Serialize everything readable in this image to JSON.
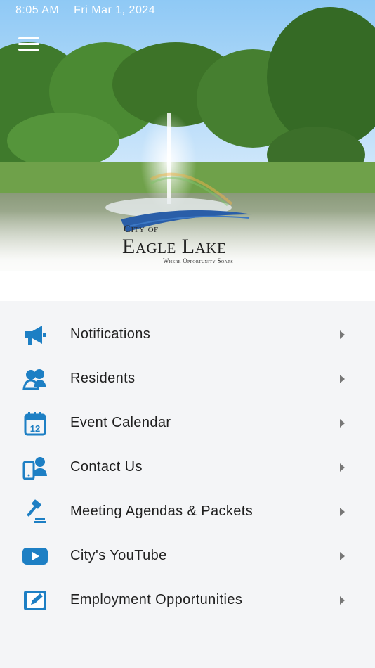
{
  "status_bar": {
    "time": "8:05 AM",
    "date": "Fri Mar 1, 2024"
  },
  "header": {
    "menu_icon": "hamburger-menu-icon",
    "logo": {
      "line1": "City of",
      "line2": "Eagle Lake",
      "tagline": "Where Opportunity Soars"
    }
  },
  "colors": {
    "accent": "#1d7fc4",
    "text": "#1f1f1f",
    "background": "#f4f5f7"
  },
  "menu": {
    "items": [
      {
        "label": "Notifications",
        "icon": "megaphone-icon"
      },
      {
        "label": "Residents",
        "icon": "people-icon"
      },
      {
        "label": "Event Calendar",
        "icon": "calendar-icon"
      },
      {
        "label": "Contact Us",
        "icon": "phone-contact-icon"
      },
      {
        "label": "Meeting Agendas & Packets",
        "icon": "gavel-icon"
      },
      {
        "label": "City's YouTube",
        "icon": "youtube-icon"
      },
      {
        "label": "Employment Opportunities",
        "icon": "edit-form-icon"
      }
    ]
  }
}
